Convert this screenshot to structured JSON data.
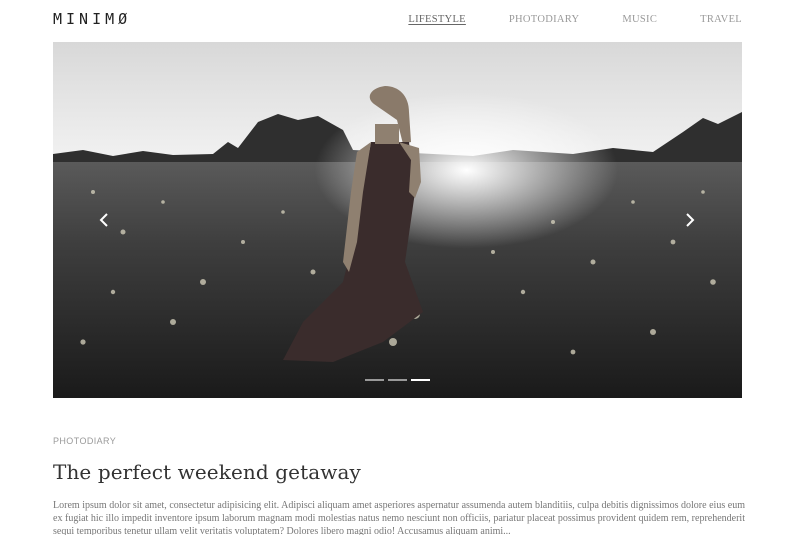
{
  "header": {
    "logo": "MINIMØ",
    "nav": [
      {
        "label": "LIFESTYLE",
        "active": true
      },
      {
        "label": "PHOTODIARY",
        "active": false
      },
      {
        "label": "MUSIC",
        "active": false
      },
      {
        "label": "TRAVEL",
        "active": false
      }
    ]
  },
  "slider": {
    "prev_icon": "chevron-left-icon",
    "next_icon": "chevron-right-icon",
    "slide_count": 3,
    "active_slide": 3
  },
  "post": {
    "category": "PHOTODIARY",
    "title": "The perfect weekend getaway",
    "excerpt": "Lorem ipsum dolor sit amet, consectetur adipisicing elit. Adipisci aliquam amet asperiores aspernatur assumenda autem blanditiis, culpa debitis dignissimos dolore eius eum ex fugiat hic illo impedit inventore ipsum laborum magnam modi molestias natus nemo nesciunt non officiis, pariatur placeat possimus provident quidem rem, reprehenderit sequi temporibus tenetur ullam velit veritatis voluptatem? Dolores libero magni odio! Accusamus aliquam animi..."
  }
}
